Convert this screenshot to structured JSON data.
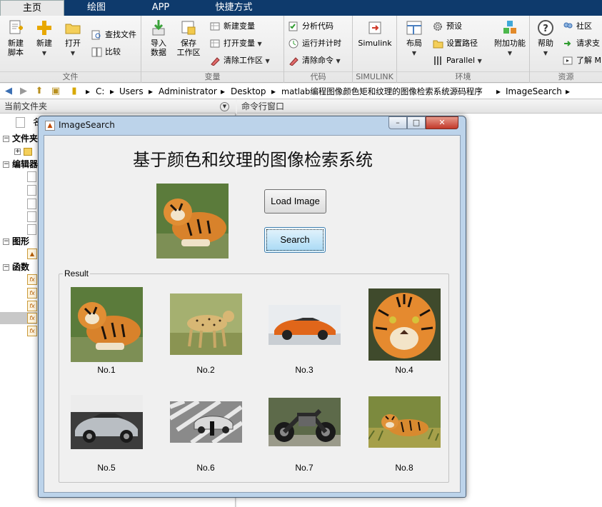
{
  "ribbon": {
    "tabs": [
      {
        "label": "主页",
        "active": true
      },
      {
        "label": "绘图",
        "active": false
      },
      {
        "label": "APP",
        "active": false
      },
      {
        "label": "快捷方式",
        "active": false
      }
    ],
    "sections": {
      "file": "文件",
      "variable": "变量",
      "code": "代码",
      "simulink": "SIMULINK",
      "environment": "环境",
      "resources": "资源"
    },
    "buttons": {
      "new_script": "新建\n脚本",
      "new": "新建",
      "open": "打开",
      "find_files": "查找文件",
      "compare": "比较",
      "import_data": "导入\n数据",
      "save_workspace": "保存\n工作区",
      "new_variable": "新建变量",
      "open_variable": "打开变量",
      "clear_workspace": "清除工作区",
      "analyze_code": "分析代码",
      "run_and_time": "运行并计时",
      "clear_commands": "清除命令",
      "simulink": "Simulink",
      "layout": "布局",
      "preferences": "预设",
      "set_path": "设置路径",
      "parallel": "Parallel",
      "add_ons": "附加功能",
      "help": "帮助",
      "community": "社区",
      "request_support": "请求支",
      "learn_more": "了解 M"
    }
  },
  "address": {
    "crumbs": [
      "C:",
      "Users",
      "Administrator",
      "Desktop",
      "matlab编程图像颜色矩和纹理的图像检索系统源码程序",
      "ImageSearch"
    ]
  },
  "left_panel": {
    "header": "当前文件夹",
    "name_col": "名",
    "tree": [
      "文件夹",
      "编辑器",
      "图形",
      "函数"
    ]
  },
  "right_panel": {
    "header": "命令行窗口"
  },
  "dialog": {
    "window_title": "ImageSearch",
    "app_title": "基于颜色和纹理的图像检索系统",
    "load_label": "Load Image",
    "search_label": "Search",
    "result_label": "Result",
    "controls": {
      "minimize": "–",
      "maximize": "□",
      "close": "✕"
    },
    "results": [
      {
        "label": "No.1",
        "kind": "tiger-lying"
      },
      {
        "label": "No.2",
        "kind": "cheetah"
      },
      {
        "label": "No.3",
        "kind": "orange-car"
      },
      {
        "label": "No.4",
        "kind": "tiger-face"
      },
      {
        "label": "No.5",
        "kind": "silver-car"
      },
      {
        "label": "No.6",
        "kind": "street-car"
      },
      {
        "label": "No.7",
        "kind": "motorcycle"
      },
      {
        "label": "No.8",
        "kind": "tiger-grass"
      }
    ]
  },
  "colors": {
    "ribbon_tab_bg": "#0e3a6c",
    "dialog_frame": "#bcd3ea",
    "search_button_focus": "#a7d9f5"
  }
}
